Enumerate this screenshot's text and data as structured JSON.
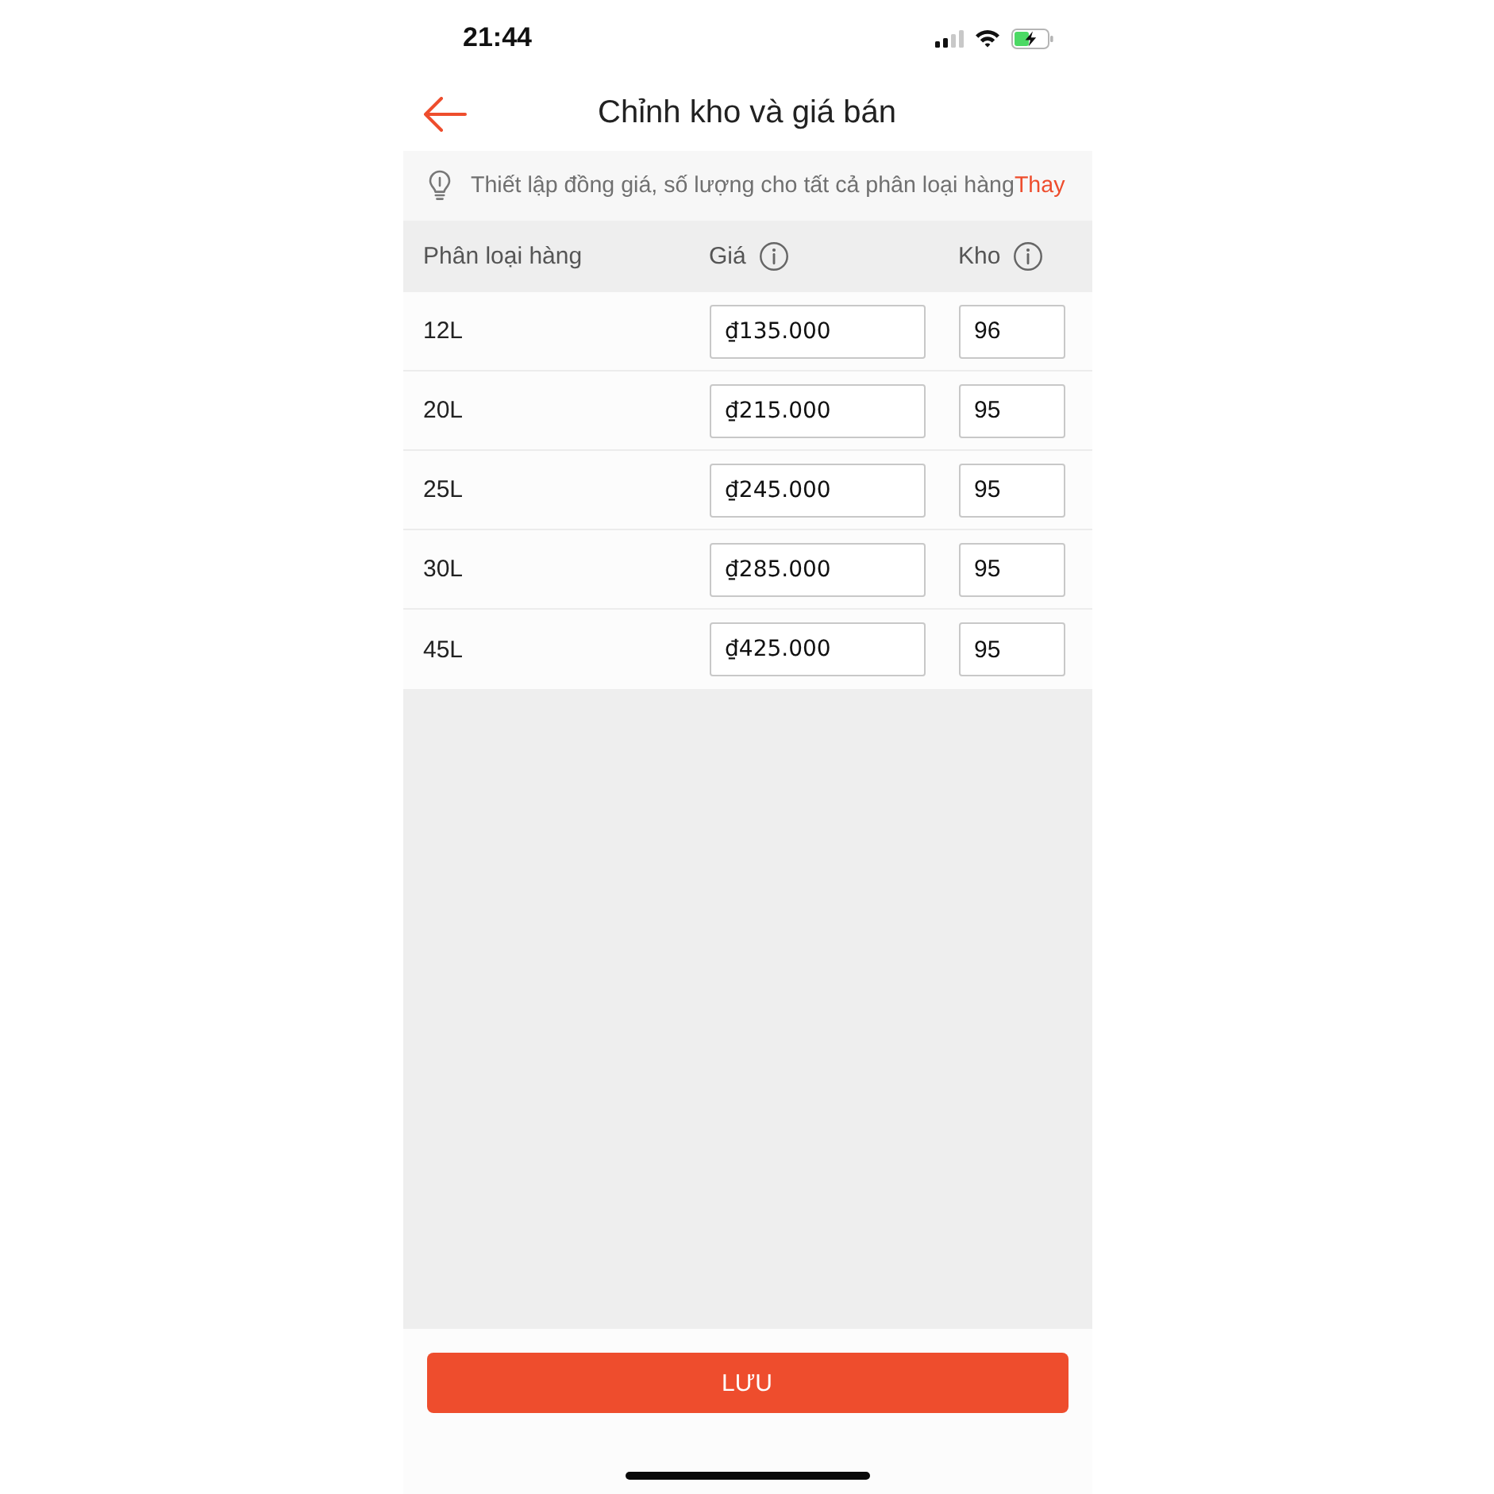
{
  "status_bar": {
    "time": "21:44"
  },
  "header": {
    "title": "Chỉnh kho và giá bán"
  },
  "hint": {
    "text": "Thiết lập đồng giá, số lượng cho tất cả phân loại hàng",
    "link": "Thay"
  },
  "table": {
    "columns": [
      {
        "label": "Phân loại hàng",
        "info": false
      },
      {
        "label": "Giá",
        "info": true
      },
      {
        "label": "Kho",
        "info": true
      }
    ],
    "rows": [
      {
        "variant": "12L",
        "price": "₫135.000",
        "stock": "96"
      },
      {
        "variant": "20L",
        "price": "₫215.000",
        "stock": "95"
      },
      {
        "variant": "25L",
        "price": "₫245.000",
        "stock": "95"
      },
      {
        "variant": "30L",
        "price": "₫285.000",
        "stock": "95"
      },
      {
        "variant": "45L",
        "price": "₫425.000",
        "stock": "95"
      }
    ]
  },
  "save_button": {
    "label": "LƯU"
  }
}
